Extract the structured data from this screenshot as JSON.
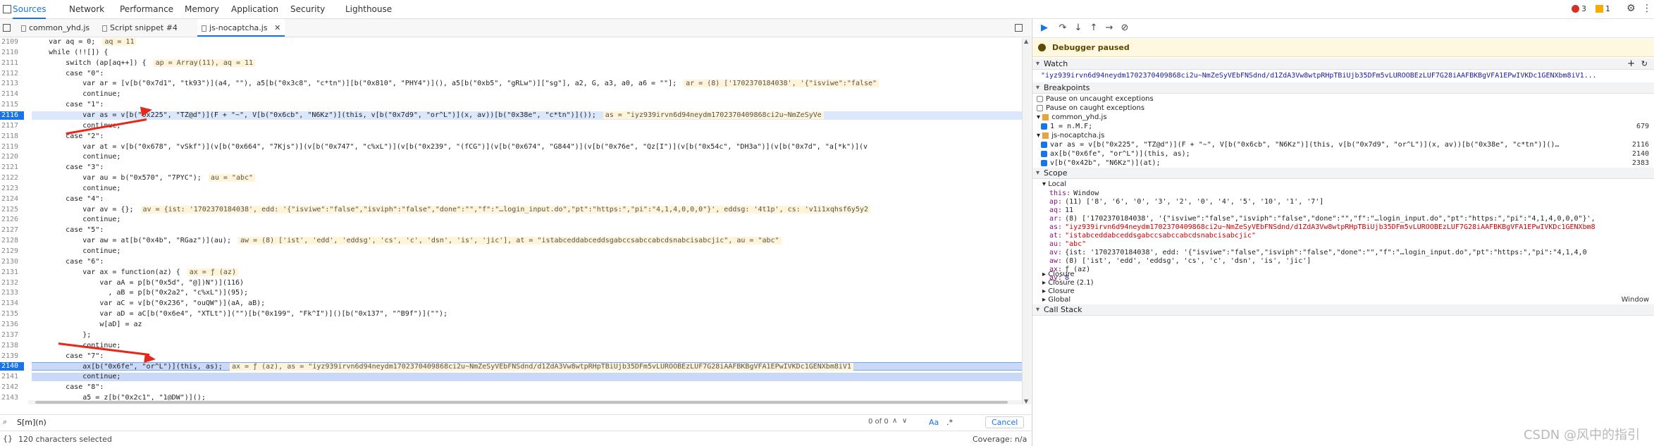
{
  "devtools_tabs": [
    "Sources",
    "Network",
    "Performance",
    "Memory",
    "Application",
    "Security",
    "Lighthouse"
  ],
  "errors": {
    "errors": "3",
    "warnings": "1"
  },
  "file_tabs": [
    "common_yhd.js",
    "Script snippet #4",
    "js-nocaptcha.js"
  ],
  "line_numbers": [
    "2109",
    "2110",
    "2111",
    "2112",
    "2113",
    "2114",
    "2115",
    "2116",
    "2117",
    "2118",
    "2119",
    "2120",
    "2121",
    "2122",
    "2123",
    "2124",
    "2125",
    "2126",
    "2127",
    "2128",
    "2129",
    "2130",
    "2131",
    "2132",
    "2133",
    "2134",
    "2135",
    "2136",
    "2137",
    "2138",
    "2139",
    "2140",
    "2141",
    "2142",
    "2143"
  ],
  "code_lines": [
    {
      "indent": "    ",
      "text": "var aq = 0;",
      "inline": "aq = 11"
    },
    {
      "indent": "    ",
      "text": "while (!![]) {",
      "inline": ""
    },
    {
      "indent": "        ",
      "text": "switch (ap[aq++]) {",
      "inline": "ap = Array(11), aq = 11"
    },
    {
      "indent": "        ",
      "text": "case \"0\":",
      "inline": ""
    },
    {
      "indent": "            ",
      "text": "var ar = [v[b(\"0x7d1\", \"tk93\")](a4, \"\"), a5[b(\"0x3c8\", \"c*tn\")][b(\"0x810\", \"PHY4\")](), a5[b(\"0xb5\", \"gRLw\")][\"sg\"], a2, G, a3, a0, a6 = \"\"];",
      "inline": "ar = (8) ['1702370184038', '{\"isviwe\":\"false\""
    },
    {
      "indent": "            ",
      "text": "continue;",
      "inline": ""
    },
    {
      "indent": "        ",
      "text": "case \"1\":",
      "inline": ""
    },
    {
      "indent": "            ",
      "text": "var as = v[b(\"0x225\", \"TZ@d\")](F + \"~\", V[b(\"0x6cb\", \"N6Kz\")](this, v[b(\"0x7d9\", \"or^L\")](x, av))[b(\"0x38e\", \"c*tn\")]());",
      "inline": "as = \"iyz939irvn6d94neydm1702370409868ci2u~NmZeSyVe"
    },
    {
      "indent": "            ",
      "text": "continue;",
      "inline": ""
    },
    {
      "indent": "        ",
      "text": "case \"2\":",
      "inline": ""
    },
    {
      "indent": "            ",
      "text": "var at = v[b(\"0x678\", \"vSkf\")](v[b(\"0x664\", \"7Kjs\")](v[b(\"0x747\", \"c%xL\")](v[b(\"0x239\", \"(fCG\")](v[b(\"0x674\", \"G844\")](v[b(\"0x76e\", \"Qz[I\")](v[b(\"0x54c\", \"DH3a\")](v[b(\"0x7d\", \"a[*k\")](v",
      "inline": ""
    },
    {
      "indent": "            ",
      "text": "continue;",
      "inline": ""
    },
    {
      "indent": "        ",
      "text": "case \"3\":",
      "inline": ""
    },
    {
      "indent": "            ",
      "text": "var au = b(\"0x570\", \"7PYC\");",
      "inline": "au = \"abc\""
    },
    {
      "indent": "            ",
      "text": "continue;",
      "inline": ""
    },
    {
      "indent": "        ",
      "text": "case \"4\":",
      "inline": ""
    },
    {
      "indent": "            ",
      "text": "var av = {};",
      "inline": "av = {ist: '1702370184038', edd: '{\"isviwe\":\"false\",\"isviph\":\"false\",\"done\":\"\",\"f\":\"…login_input.do\",\"pt\":\"https:\",\"pi\":\"4,1,4,0,0,0\"}', eddsg: '4t1p', cs: 'v1i1xqhsf6y5y2"
    },
    {
      "indent": "            ",
      "text": "continue;",
      "inline": ""
    },
    {
      "indent": "        ",
      "text": "case \"5\":",
      "inline": ""
    },
    {
      "indent": "            ",
      "text": "var aw = at[b(\"0x4b\", \"RGaz\")](au);",
      "inline": "aw = (8) ['ist', 'edd', 'eddsg', 'cs', 'c', 'dsn', 'is', 'jic'], at = \"istabceddabceddsgabccsabccabcdsnabcisabcjic\", au = \"abc\""
    },
    {
      "indent": "            ",
      "text": "continue;",
      "inline": ""
    },
    {
      "indent": "        ",
      "text": "case \"6\":",
      "inline": ""
    },
    {
      "indent": "            ",
      "text": "var ax = function(az) {",
      "inline": "ax = ƒ (az)"
    },
    {
      "indent": "                ",
      "text": "var aA = p[b(\"0x5d\", \"@])N\")](116)",
      "inline": ""
    },
    {
      "indent": "                  ",
      "text": ", aB = p[b(\"0x2a2\", \"c%xL\")](95);",
      "inline": ""
    },
    {
      "indent": "                ",
      "text": "var aC = v[b(\"0x236\", \"ouQW\")](aA, aB);",
      "inline": ""
    },
    {
      "indent": "                ",
      "text": "var aD = aC[b(\"0x6e4\", \"XTLt\")](\"\")[b(\"0x199\", \"Fk^I\")]()[b(\"0x137\", \"^B9f\")](\"\");",
      "inline": ""
    },
    {
      "indent": "                ",
      "text": "w[aD] = az",
      "inline": ""
    },
    {
      "indent": "            ",
      "text": "};",
      "inline": ""
    },
    {
      "indent": "            ",
      "text": "continue;",
      "inline": ""
    },
    {
      "indent": "        ",
      "text": "case \"7\":",
      "inline": ""
    },
    {
      "indent": "            ",
      "text": "ax[b(\"0x6fe\", \"or^L\")](this, as);",
      "inline": "ax = ƒ (az), as = \"iyz939irvn6d94neydm1702370409868ci2u~NmZeSyVEbFNSdnd/d1ZdA3Vw8wtpRHpTBiUjb35DFm5vLUROOBEzLUF7G28iAAFBKBgVFA1EPwIVKDc1GENXbm8iV1"
    },
    {
      "indent": "            ",
      "text": "continue;",
      "inline": ""
    },
    {
      "indent": "        ",
      "text": "case \"8\":",
      "inline": ""
    },
    {
      "indent": "            ",
      "text": "a5 = z[b(\"0x2c1\", \"1@DW\")]();",
      "inline": ""
    }
  ],
  "search": {
    "value": "S[m](n)",
    "count": "0 of 0",
    "aa": "Aa",
    "regex": ".*",
    "cancel": "Cancel"
  },
  "status": {
    "selected": "120 characters selected",
    "coverage": "Coverage: n/a"
  },
  "debugger": {
    "paused": "Debugger paused",
    "watch_title": "Watch",
    "watch_row": "\"iyz939irvn6d94neydm1702370409868ci2u~NmZeSyVEbFNSdnd/d1ZdA3Vw8wtpRHpTBiUjb35DFm5vLUROOBEzLUF7G28iAAFBKBgVFA1EPwIVKDc1GENXbm8iV1...",
    "breakpoints_title": "Breakpoints",
    "pause_uncaught": "Pause on uncaught exceptions",
    "pause_caught": "Pause on caught exceptions",
    "bp_files": [
      {
        "file": "common_yhd.js",
        "items": [
          {
            "code": "1 = n.M.F;",
            "line": "679"
          }
        ]
      },
      {
        "file": "js-nocaptcha.js",
        "items": [
          {
            "code": "var as = v[b(\"0x225\", \"TZ@d\")](F + \"~\", V[b(\"0x6cb\", \"N6Kz\")](this, v[b(\"0x7d9\", \"or^L\")](x, av))[b(\"0x38e\", \"c*tn\")]()…",
            "line": "2116"
          },
          {
            "code": "ax[b(\"0x6fe\", \"or^L\")](this, as);",
            "line": "2140"
          },
          {
            "code": "v[b(\"0x42b\", \"N6Kz\")](at);",
            "line": "2383"
          }
        ]
      }
    ],
    "scope_title": "Scope",
    "local_title": "Local",
    "scope_rows": [
      {
        "k": "this:",
        "v": "Window",
        "type": "plain"
      },
      {
        "k": "ap:",
        "v": "(11) ['8', '6', '0', '3', '2', '0', '4', '5', '10', '1', '7']",
        "type": "arr"
      },
      {
        "k": "aq:",
        "v": "11",
        "type": "num"
      },
      {
        "k": "ar:",
        "v": "(8) ['1702370184038', '{\"isviwe\":\"false\",\"isviph\":\"false\",\"done\":\"\",\"f\":\"…login_input.do\",\"pt\":\"https:\",\"pi\":\"4,1,4,0,0,0\"}',",
        "type": "arr"
      },
      {
        "k": "as:",
        "v": "\"iyz939irvn6d94neydm1702370409868ci2u~NmZeSyVEbFNSdnd/d1ZdA3Vw8wtpRHpTBiUjb35DFm5vLUROOBEzLUF7G28iAAFBKBgVFA1EPwIVKDc1GENXbm8",
        "type": "str"
      },
      {
        "k": "at:",
        "v": "\"istabceddabceddsgabccsabccabcdsnabcisabcjic\"",
        "type": "str"
      },
      {
        "k": "au:",
        "v": "\"abc\"",
        "type": "str"
      },
      {
        "k": "av:",
        "v": "{ist: '1702370184038', edd: '{\"isviwe\":\"false\",\"isviph\":\"false\",\"done\":\"\",\"f\":\"…login_input.do\",\"pt\":\"https:\",\"pi\":\"4,1,4,0",
        "type": "arr"
      },
      {
        "k": "aw:",
        "v": "(8) ['ist', 'edd', 'eddsg', 'cs', 'c', 'dsn', 'is', 'jic']",
        "type": "arr"
      },
      {
        "k": "ax:",
        "v": "ƒ (az)",
        "type": "fn"
      },
      {
        "k": "ay:",
        "v": "8",
        "type": "num"
      }
    ],
    "closures": [
      "Closure",
      "Closure (2.1)",
      "Closure"
    ],
    "global": "Global",
    "global_val": "Window",
    "callstack_title": "Call Stack"
  },
  "watermark": "CSDN @风中的指引",
  "colors": {
    "accent": "#1a73e8",
    "arrow": "#e8261a",
    "paused_bg": "#fff8e1"
  }
}
